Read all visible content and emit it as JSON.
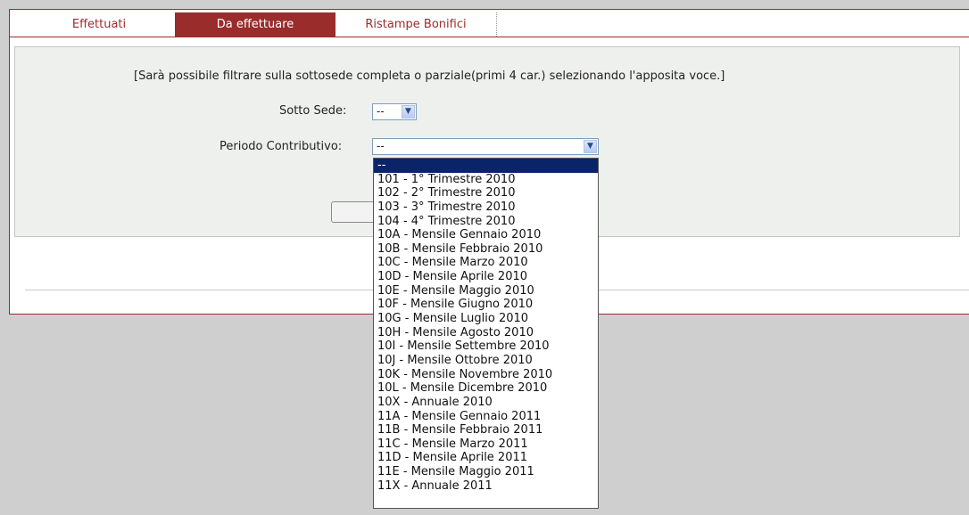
{
  "tabs": [
    {
      "label": "Effettuati"
    },
    {
      "label": "Da effettuare"
    },
    {
      "label": "Ristampe Bonifici"
    }
  ],
  "filter": {
    "note": "[Sarà possibile filtrare sulla sottosede completa o parziale(primi 4 car.) selezionando l'apposita voce.]",
    "sotto_sede_label": "Sotto Sede:",
    "sotto_sede_value": "--",
    "periodo_label": "Periodo Contributivo:",
    "periodo_value": "--"
  },
  "icons": {
    "dropdown_arrow": "chevron-down-icon",
    "dropdown_arrow_glyph": "▼"
  },
  "colors": {
    "accent": "#9b2c2c",
    "selection": "#0a246a"
  },
  "periodo_options": [
    "--",
    "101 - 1° Trimestre 2010",
    "102 - 2° Trimestre 2010",
    "103 - 3° Trimestre 2010",
    "104 - 4° Trimestre 2010",
    "10A - Mensile Gennaio 2010",
    "10B - Mensile Febbraio 2010",
    "10C - Mensile Marzo 2010",
    "10D - Mensile Aprile 2010",
    "10E - Mensile Maggio 2010",
    "10F - Mensile Giugno 2010",
    "10G - Mensile Luglio 2010",
    "10H - Mensile Agosto 2010",
    "10I - Mensile Settembre 2010",
    "10J - Mensile Ottobre 2010",
    "10K - Mensile Novembre 2010",
    "10L - Mensile Dicembre 2010",
    "10X - Annuale 2010",
    "11A - Mensile Gennaio 2011",
    "11B - Mensile Febbraio 2011",
    "11C - Mensile Marzo 2011",
    "11D - Mensile Aprile 2011",
    "11E - Mensile Maggio 2011",
    "11X - Annuale 2011"
  ]
}
